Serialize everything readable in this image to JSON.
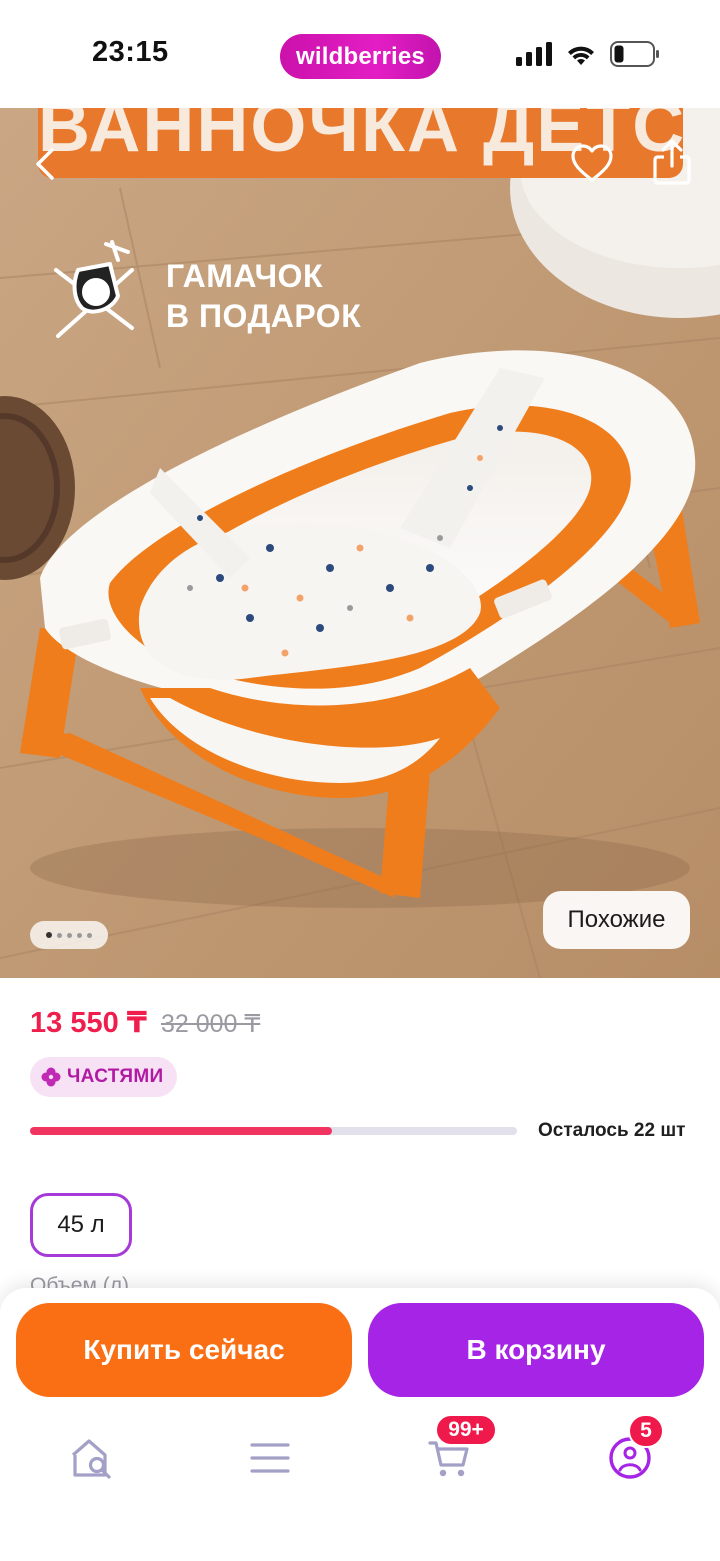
{
  "status_bar": {
    "time": "23:15",
    "brand": "wildberries"
  },
  "hero": {
    "banner_text": "ВАННОЧКА ДЕТСКАЯ",
    "gift_text": "ГАМАЧОК\nВ ПОДАРОК",
    "gallery_position": 1,
    "similar_label": "Похожие"
  },
  "product": {
    "price_current": "13 550 ₸",
    "price_old": "32 000 ₸",
    "installment_label": "ЧАСТЯМИ",
    "stock_label": "Осталось 22 шт",
    "stock_fill_percent": 62,
    "volume_option": "45 л",
    "volume_label": "Объем (л)"
  },
  "actions": {
    "buy_now": "Купить сейчас",
    "add_to_cart": "В корзину"
  },
  "tabbar": {
    "cart_badge": "99+",
    "profile_badge": "5"
  },
  "colors": {
    "brand": "#cb11ab",
    "price": "#f01e4c",
    "buy_now": "#fa6f14",
    "add_to_cart": "#a524e6",
    "tab_icon": "#a3a0c8"
  }
}
